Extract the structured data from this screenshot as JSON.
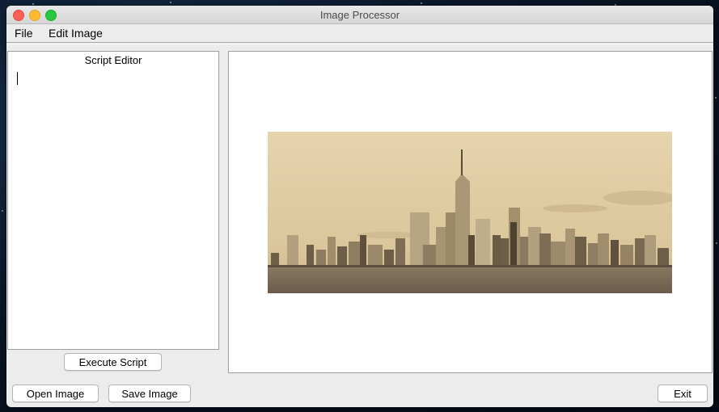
{
  "window": {
    "title": "Image Processor"
  },
  "menu": {
    "items": [
      "File",
      "Edit Image"
    ]
  },
  "editor": {
    "title": "Script Editor",
    "content": ""
  },
  "buttons": {
    "execute": "Execute Script",
    "open": "Open Image",
    "save": "Save Image",
    "exit": "Exit"
  },
  "image": {
    "filter": "sepia",
    "subject": "city skyline over water"
  },
  "colors": {
    "close": "#fc5f57",
    "minimize": "#fdbc2e",
    "maximize": "#28c840",
    "sepia_sky": "#dcc8a0",
    "sepia_dark": "#3a3025"
  }
}
